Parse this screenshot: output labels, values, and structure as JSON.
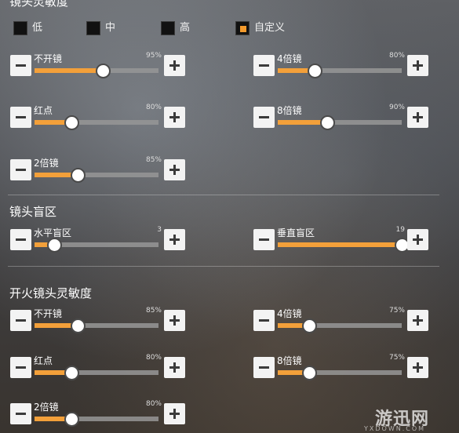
{
  "section_titles": {
    "camera": "镜头灵敏度",
    "deadzone": "镜头盲区",
    "fire": "开火镜头灵敏度"
  },
  "presets": [
    {
      "label": "低",
      "checked": false
    },
    {
      "label": "中",
      "checked": false
    },
    {
      "label": "高",
      "checked": false
    },
    {
      "label": "自定义",
      "checked": true
    }
  ],
  "camera_sliders": [
    {
      "label": "不开镜",
      "value_text": "95%",
      "level": 0.55
    },
    {
      "label": "4倍镜",
      "value_text": "80%",
      "level": 0.3
    },
    {
      "label": "红点",
      "value_text": "80%",
      "level": 0.3
    },
    {
      "label": "8倍镜",
      "value_text": "90%",
      "level": 0.4
    },
    {
      "label": "2倍镜",
      "value_text": "85%",
      "level": 0.35
    }
  ],
  "deadzone_sliders": [
    {
      "label": "水平盲区",
      "value_text": "3",
      "level": 0.16
    },
    {
      "label": "垂直盲区",
      "value_text": "19",
      "level": 1.0
    }
  ],
  "fire_sliders": [
    {
      "label": "不开镜",
      "value_text": "85%",
      "level": 0.35
    },
    {
      "label": "4倍镜",
      "value_text": "75%",
      "level": 0.25
    },
    {
      "label": "红点",
      "value_text": "80%",
      "level": 0.3
    },
    {
      "label": "8倍镜",
      "value_text": "75%",
      "level": 0.25
    },
    {
      "label": "2倍镜",
      "value_text": "80%",
      "level": 0.3
    }
  ],
  "watermark": {
    "main": "游迅网",
    "sub": "YXDOWN.COM"
  },
  "colors": {
    "accent": "#f3a03a",
    "track": "#969696",
    "button": "#f3f3f3"
  }
}
